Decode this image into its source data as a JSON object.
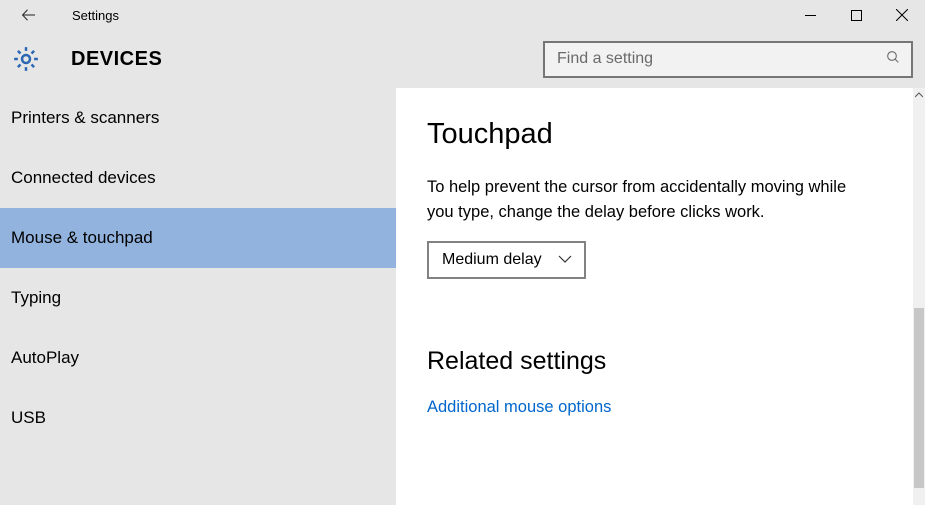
{
  "window": {
    "title": "Settings"
  },
  "header": {
    "category": "DEVICES",
    "search_placeholder": "Find a setting"
  },
  "sidebar": {
    "items": [
      {
        "label": "Printers & scanners",
        "selected": false
      },
      {
        "label": "Connected devices",
        "selected": false
      },
      {
        "label": "Mouse & touchpad",
        "selected": true
      },
      {
        "label": "Typing",
        "selected": false
      },
      {
        "label": "AutoPlay",
        "selected": false
      },
      {
        "label": "USB",
        "selected": false
      }
    ]
  },
  "main": {
    "section_title": "Touchpad",
    "description": "To help prevent the cursor from accidentally moving while you type, change the delay before clicks work.",
    "delay_dropdown": {
      "value": "Medium delay"
    },
    "related_title": "Related settings",
    "related_link": "Additional mouse options"
  }
}
